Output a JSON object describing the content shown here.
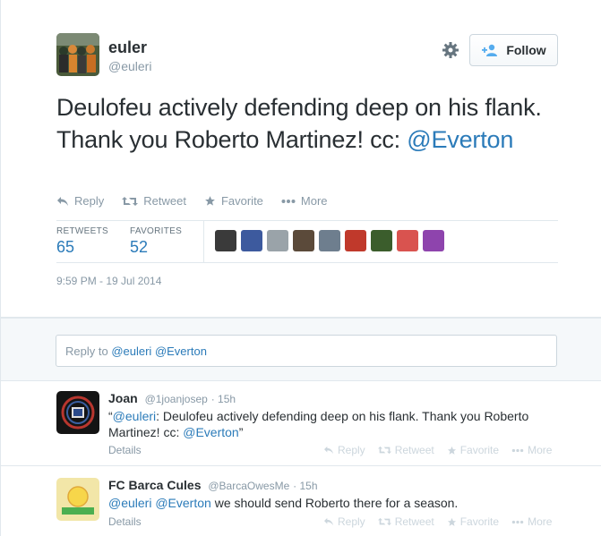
{
  "tweet": {
    "name": "euler",
    "handle": "@euleri",
    "follow_label": "Follow",
    "text_part1": "Deulofeu actively defending deep on his flank. Thank you Roberto Martinez! cc: ",
    "text_mention": "@Everton",
    "actions": {
      "reply": "Reply",
      "retweet": "Retweet",
      "favorite": "Favorite",
      "more": "More"
    },
    "stats": {
      "retweets_label": "RETWEETS",
      "retweets_value": "65",
      "favorites_label": "FAVORITES",
      "favorites_value": "52"
    },
    "favoriters": [
      {
        "name": "favoriter-1",
        "color": "#3a3a3a"
      },
      {
        "name": "favoriter-2",
        "color": "#3d5a9e"
      },
      {
        "name": "favoriter-3",
        "color": "#9aa3a9"
      },
      {
        "name": "favoriter-4",
        "color": "#5b4a3a"
      },
      {
        "name": "favoriter-5",
        "color": "#6e7e8e"
      },
      {
        "name": "favoriter-6",
        "color": "#c0392b"
      },
      {
        "name": "favoriter-7",
        "color": "#3b5d2c"
      },
      {
        "name": "favoriter-8",
        "color": "#d9534f"
      },
      {
        "name": "favoriter-9",
        "color": "#8e44ad"
      }
    ],
    "timestamp": "9:59 PM - 19 Jul 2014"
  },
  "reply_box": {
    "prefix": "Reply to ",
    "mention1": "@euleri",
    "mention2": "@Everton"
  },
  "replies": [
    {
      "name": "Joan",
      "handle": "@1joanjosep",
      "time": "· 15h",
      "text_open": "“",
      "mention": "@euleri",
      "text_mid": ": Deulofeu actively defending deep on his flank. Thank you Roberto Martinez! cc: ",
      "mention2": "@Everton",
      "text_close": "”",
      "details": "Details",
      "reply": "Reply",
      "retweet": "Retweet",
      "favorite": "Favorite",
      "more": "More"
    },
    {
      "name": "FC Barca Cules",
      "handle": "@BarcaOwesMe",
      "time": "· 15h",
      "mention": "@euleri",
      "mention2": "@Everton",
      "text_rest": " we should send Roberto there for a season.",
      "details": "Details",
      "reply": "Reply",
      "retweet": "Retweet",
      "favorite": "Favorite",
      "more": "More"
    }
  ],
  "colors": {
    "link": "#2b7bb9",
    "muted": "#8899a6",
    "text": "#292f33"
  }
}
